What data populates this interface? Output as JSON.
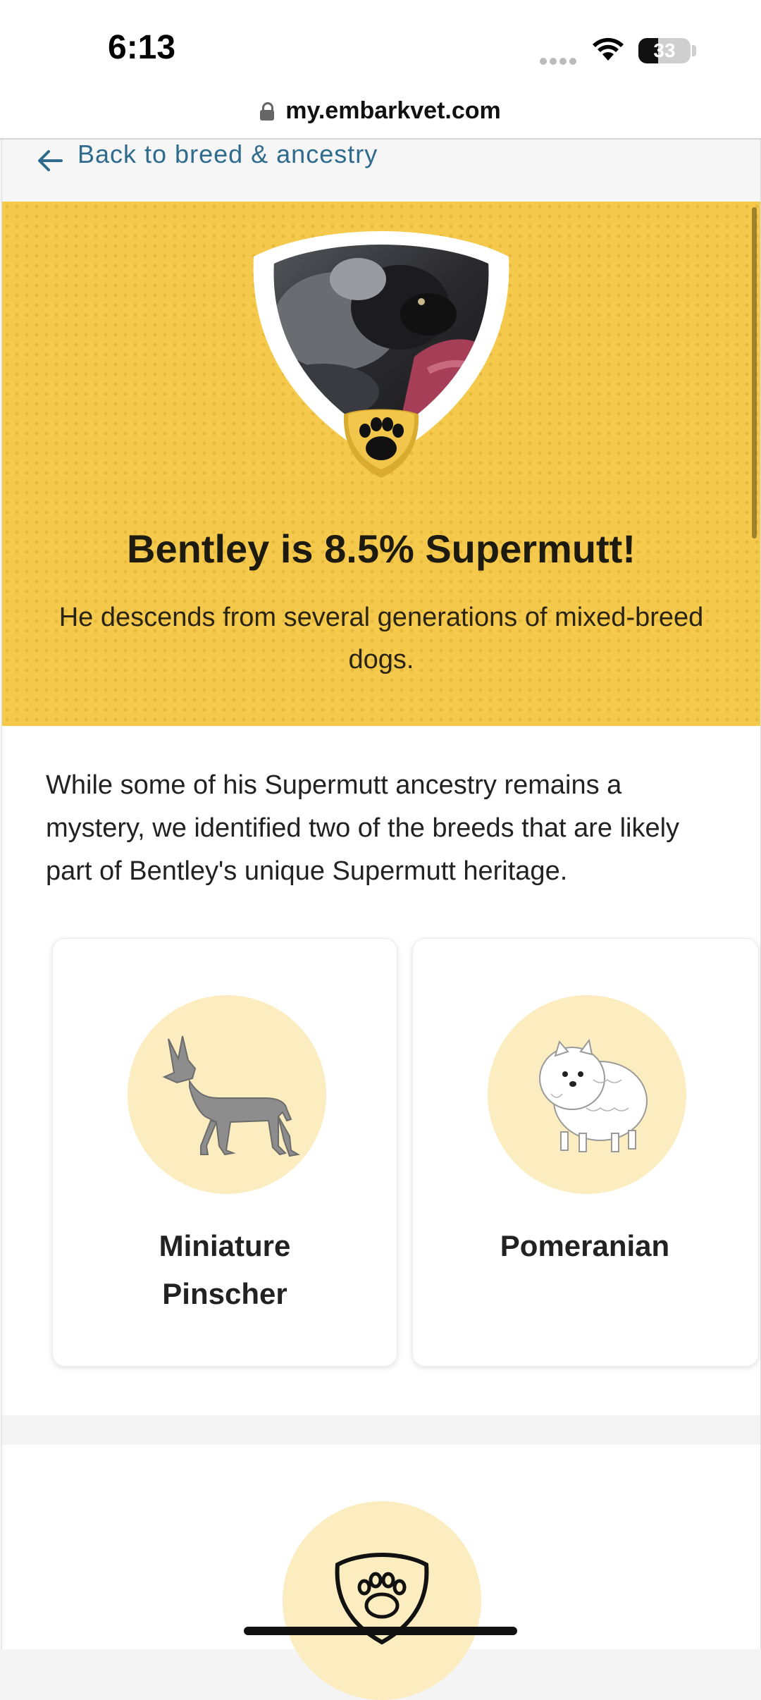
{
  "status_bar": {
    "time": "6:13",
    "battery": "33"
  },
  "browser": {
    "url": "my.embarkvet.com"
  },
  "nav": {
    "back_label": "Back to breed & ancestry"
  },
  "hero": {
    "title": "Bentley is 8.5% Supermutt!",
    "subtitle": "He descends from several generations of mixed-breed dogs.",
    "icon": "paw-icon",
    "bg_color": "#f5c94c"
  },
  "intro_text": "While some of his Supermutt ancestry remains a mystery, we identified two of the breeds that are likely part of Bentley's unique Supermutt heritage.",
  "breeds": [
    {
      "name_line1": "Miniature",
      "name_line2": "Pinscher",
      "icon": "miniature-pinscher-illustration"
    },
    {
      "name_line1": "Pomeranian",
      "icon": "pomeranian-illustration"
    }
  ],
  "bottom_icon": "paw-shield-icon",
  "colors": {
    "accent_link": "#2f6b8c",
    "circle_bg": "#fbedbf"
  }
}
